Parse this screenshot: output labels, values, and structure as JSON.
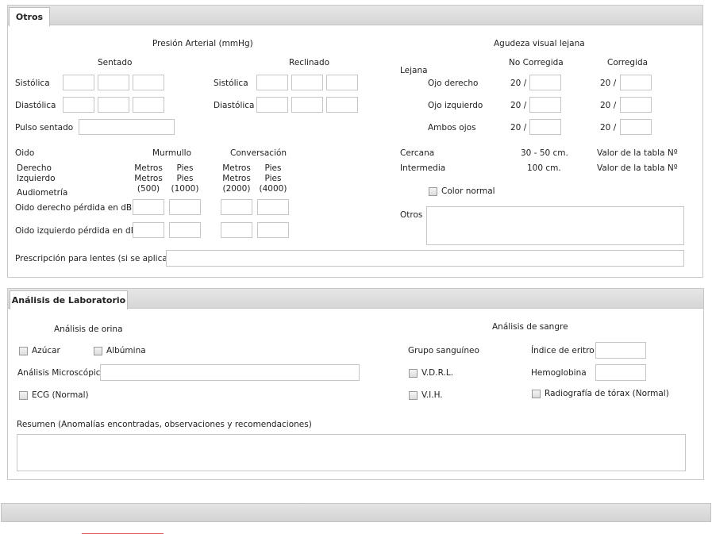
{
  "otros": {
    "tab": "Otros",
    "presion": {
      "title": "Presión Arterial (mmHg)",
      "sentado": "Sentado",
      "reclinado": "Reclinado",
      "sistolica": "Sistólica",
      "diastolica": "Diastólica",
      "pulso": "Pulso sentado"
    },
    "oido": {
      "oido": "Oido",
      "murmullo": "Murmullo",
      "conversacion": "Conversación",
      "derecho": "Derecho",
      "izquierdo": "Izquierdo",
      "audiometria": "Audiometría",
      "metros": "Metros",
      "pies": "Pies",
      "f500": "(500)",
      "f1000": "(1000)",
      "f2000": "(2000)",
      "f4000": "(4000)",
      "der_perdida": "Oido derecho pérdida en dB",
      "izq_perdida": "Oido izquierdo pérdida en dB"
    },
    "prescripcion": "Prescripción para lentes (si se aplica)",
    "agudeza": {
      "title": "Agudeza visual lejana",
      "lejana": "Lejana",
      "no_corregida": "No Corregida",
      "corregida": "Corregida",
      "ojo_derecho": "Ojo derecho",
      "ojo_izquierdo": "Ojo izquierdo",
      "ambos_ojos": "Ambos ojos",
      "veinte": "20 /",
      "cercana": "Cercana",
      "cercana_dist": "30 - 50 cm.",
      "intermedia": "Intermedia",
      "intermedia_dist": "100 cm.",
      "valor_tabla": "Valor de la tabla Nº",
      "color_normal": "Color normal",
      "otros": "Otros"
    }
  },
  "lab": {
    "tab": "Análisis de Laboratorio",
    "orina": "Análisis de orina",
    "azucar": "Azúcar",
    "albumina": "Albúmina",
    "microscopico": "Análisis Microscópico",
    "ecg": "ECG (Normal)",
    "sangre": "Análisis de sangre",
    "grupo": "Grupo sanguíneo",
    "indice": "Índice de eritro",
    "vdrl": "V.D.R.L.",
    "hemoglobina": "Hemoglobina",
    "vih": "V.I.H.",
    "radiografia": "Radiografía de tórax (Normal)",
    "resumen": "Resumen (Anomalías encontradas, observaciones y recomendaciones)"
  }
}
